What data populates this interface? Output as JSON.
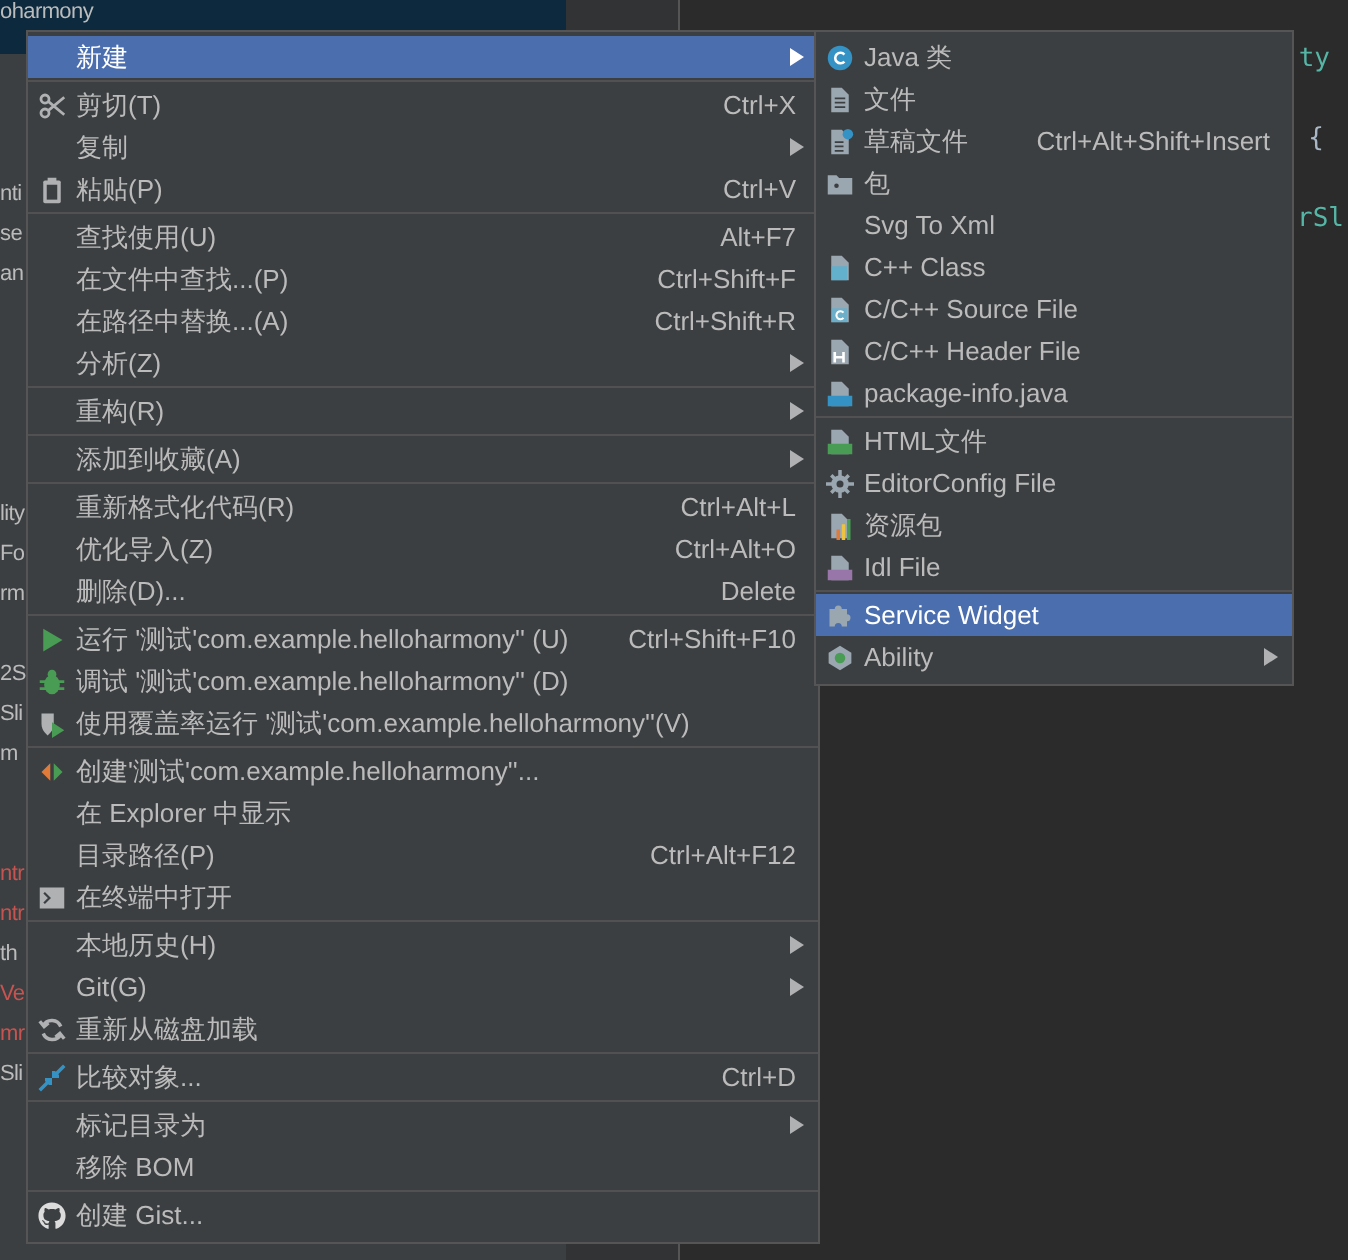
{
  "project_tree": {
    "rows": [
      {
        "kind": "text",
        "text": "oharmony",
        "selected": true,
        "color": "#bbbbbb"
      },
      {
        "kind": "blank"
      },
      {
        "kind": "blank"
      },
      {
        "kind": "blank"
      },
      {
        "kind": "text",
        "text": "nti",
        "selected": false,
        "color": "#bbbbbb"
      },
      {
        "kind": "text",
        "text": "se",
        "selected": false,
        "color": "#bbbbbb"
      },
      {
        "kind": "text",
        "text": "an",
        "selected": false,
        "color": "#bbbbbb"
      },
      {
        "kind": "blank"
      },
      {
        "kind": "blank"
      },
      {
        "kind": "blank"
      },
      {
        "kind": "blank"
      },
      {
        "kind": "blank"
      },
      {
        "kind": "text",
        "text": "lity",
        "selected": false,
        "color": "#bbbbbb"
      },
      {
        "kind": "text",
        "text": "Fo",
        "selected": false,
        "color": "#bbbbbb"
      },
      {
        "kind": "text",
        "text": "rm",
        "selected": false,
        "color": "#bbbbbb"
      },
      {
        "kind": "blank"
      },
      {
        "kind": "text",
        "text": "2S",
        "selected": false,
        "color": "#bbbbbb"
      },
      {
        "kind": "text",
        "text": "Sli",
        "selected": false,
        "color": "#bbbbbb"
      },
      {
        "kind": "text",
        "text": "m",
        "selected": false,
        "color": "#bbbbbb"
      },
      {
        "kind": "blank"
      },
      {
        "kind": "blank"
      },
      {
        "kind": "text",
        "text": "ntr",
        "selected": false,
        "color": "#c75450"
      },
      {
        "kind": "text",
        "text": "ntr",
        "selected": false,
        "color": "#c75450"
      },
      {
        "kind": "text",
        "text": "th",
        "selected": false,
        "color": "#bbbbbb"
      },
      {
        "kind": "text",
        "text": "Ve",
        "selected": false,
        "color": "#c75450"
      },
      {
        "kind": "text",
        "text": "mr",
        "selected": false,
        "color": "#c75450"
      },
      {
        "kind": "text",
        "text": "Sli",
        "selected": false,
        "color": "#bbbbbb"
      }
    ]
  },
  "editor": {
    "lines": [
      {
        "kind": "blank"
      },
      {
        "kind": "text",
        "text": "ty"
      },
      {
        "kind": "blank"
      },
      {
        "kind": "text",
        "text": "{"
      },
      {
        "kind": "blank"
      },
      {
        "kind": "text",
        "text": "rSl"
      }
    ]
  },
  "context_menu": {
    "groups": [
      [
        {
          "label": "新建",
          "submenu": true,
          "selected": true
        }
      ],
      [
        {
          "label": "剪切(T)",
          "shortcut": "Ctrl+X",
          "submenu": false,
          "selected": false
        },
        {
          "label": "复制",
          "submenu": true,
          "selected": false
        },
        {
          "label": "粘贴(P)",
          "shortcut": "Ctrl+V",
          "submenu": false,
          "selected": false
        }
      ],
      [
        {
          "label": "查找使用(U)",
          "shortcut": "Alt+F7",
          "submenu": false,
          "selected": false
        },
        {
          "label": "在文件中查找...(P)",
          "shortcut": "Ctrl+Shift+F",
          "submenu": false,
          "selected": false
        },
        {
          "label": "在路径中替换...(A)",
          "shortcut": "Ctrl+Shift+R",
          "submenu": false,
          "selected": false
        },
        {
          "label": "分析(Z)",
          "submenu": true,
          "selected": false
        }
      ],
      [
        {
          "label": "重构(R)",
          "submenu": true,
          "selected": false
        }
      ],
      [
        {
          "label": "添加到收藏(A)",
          "submenu": true,
          "selected": false
        }
      ],
      [
        {
          "label": "重新格式化代码(R)",
          "shortcut": "Ctrl+Alt+L",
          "submenu": false,
          "selected": false
        },
        {
          "label": "优化导入(Z)",
          "shortcut": "Ctrl+Alt+O",
          "submenu": false,
          "selected": false
        },
        {
          "label": "删除(D)...",
          "shortcut": "Delete",
          "submenu": false,
          "selected": false
        }
      ],
      [
        {
          "label": "运行 '测试'com.example.helloharmony'' (U)",
          "shortcut": "Ctrl+Shift+F10",
          "submenu": false,
          "selected": false
        },
        {
          "label": "调试 '测试'com.example.helloharmony'' (D)",
          "submenu": false,
          "selected": false
        },
        {
          "label": "使用覆盖率运行  '测试'com.example.helloharmony''(V)",
          "submenu": false,
          "selected": false
        }
      ],
      [
        {
          "label": "创建'测试'com.example.helloharmony''...",
          "submenu": false,
          "selected": false
        },
        {
          "label": "在 Explorer 中显示",
          "submenu": false,
          "selected": false
        },
        {
          "label": "目录路径(P)",
          "shortcut": "Ctrl+Alt+F12",
          "submenu": false,
          "selected": false
        },
        {
          "label": "在终端中打开",
          "submenu": false,
          "selected": false
        }
      ],
      [
        {
          "label": "本地历史(H)",
          "submenu": true,
          "selected": false
        },
        {
          "label": "Git(G)",
          "submenu": true,
          "selected": false
        },
        {
          "label": "重新从磁盘加载",
          "submenu": false,
          "selected": false
        }
      ],
      [
        {
          "label": "比较对象...",
          "shortcut": "Ctrl+D",
          "submenu": false,
          "selected": false
        }
      ],
      [
        {
          "label": "标记目录为",
          "submenu": true,
          "selected": false
        },
        {
          "label": "移除 BOM",
          "submenu": false,
          "selected": false
        }
      ],
      [
        {
          "label": "创建 Gist...",
          "submenu": false,
          "selected": false
        }
      ]
    ]
  },
  "submenu": {
    "groups": [
      [
        {
          "label": "Java 类",
          "submenu": false,
          "selected": false
        },
        {
          "label": "文件",
          "submenu": false,
          "selected": false
        },
        {
          "label": "草稿文件",
          "shortcut": "Ctrl+Alt+Shift+Insert",
          "submenu": false,
          "selected": false
        },
        {
          "label": "包",
          "submenu": false,
          "selected": false
        },
        {
          "label": "Svg To Xml",
          "submenu": false,
          "selected": false
        },
        {
          "label": "C++ Class",
          "submenu": false,
          "selected": false
        },
        {
          "label": "C/C++ Source File",
          "submenu": false,
          "selected": false
        },
        {
          "label": "C/C++ Header File",
          "submenu": false,
          "selected": false
        },
        {
          "label": "package-info.java",
          "submenu": false,
          "selected": false
        }
      ],
      [
        {
          "label": "HTML文件",
          "submenu": false,
          "selected": false
        },
        {
          "label": "EditorConfig File",
          "submenu": false,
          "selected": false
        },
        {
          "label": "资源包",
          "submenu": false,
          "selected": false
        },
        {
          "label": "Idl File",
          "submenu": false,
          "selected": false
        }
      ],
      [
        {
          "label": "Service Widget",
          "submenu": false,
          "selected": true
        },
        {
          "label": "Ability",
          "submenu": true,
          "selected": false
        }
      ]
    ]
  }
}
